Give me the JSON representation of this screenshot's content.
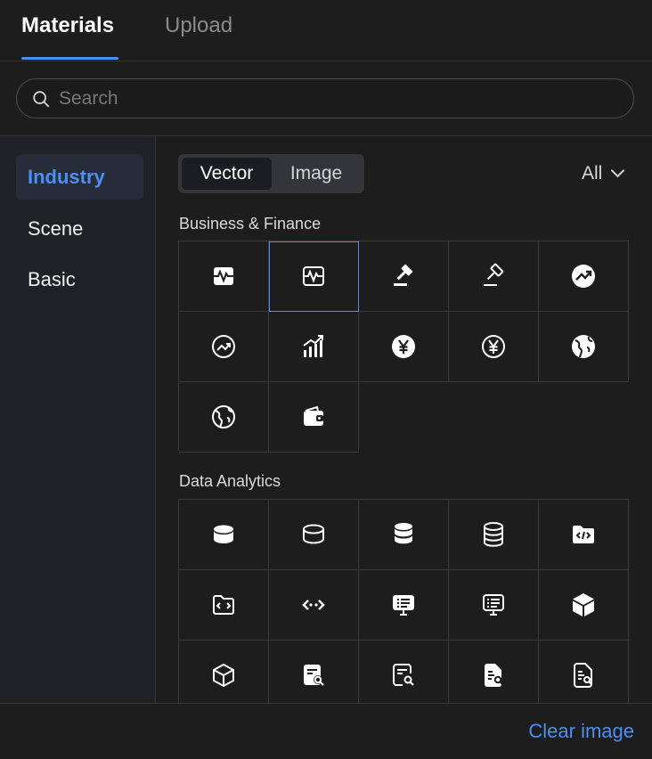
{
  "tabs": {
    "materials": "Materials",
    "upload": "Upload"
  },
  "search": {
    "placeholder": "Search"
  },
  "sidebar": {
    "items": [
      {
        "label": "Industry"
      },
      {
        "label": "Scene"
      },
      {
        "label": "Basic"
      }
    ]
  },
  "segment": {
    "vector": "Vector",
    "image": "Image"
  },
  "filter": {
    "label": "All"
  },
  "sections": [
    {
      "title": "Business & Finance"
    },
    {
      "title": "Data Analytics"
    }
  ],
  "icons": {
    "business": [
      "pulse-monitor-filled-icon",
      "pulse-monitor-outline-icon",
      "gavel-filled-icon",
      "gavel-outline-icon",
      "trend-circle-filled-icon",
      "trend-circle-outline-icon",
      "bar-chart-growth-icon",
      "yen-circle-filled-icon",
      "yen-circle-outline-icon",
      "globe-filled-icon",
      "globe-outline-icon",
      "wallet-icon"
    ],
    "data": [
      "database-filled-icon",
      "database-outline-icon",
      "database-stack-filled-icon",
      "database-stack-outline-icon",
      "code-folder-filled-icon",
      "code-folder-outline-icon",
      "code-arrows-icon",
      "monitor-list-filled-icon",
      "monitor-list-outline-icon",
      "cube-filled-icon",
      "cube-outline-icon",
      "report-search-filled-icon",
      "report-search-outline-icon",
      "document-search-filled-icon",
      "document-search-outline-icon"
    ]
  },
  "footer": {
    "clear_label": "Clear image"
  },
  "colors": {
    "accent": "#4d8ff2",
    "background": "#1d1d1e",
    "sidebar_active_bg": "#262c38"
  }
}
